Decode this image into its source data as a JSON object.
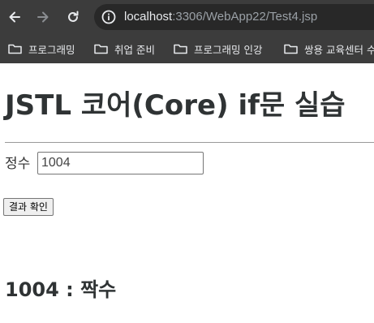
{
  "browser": {
    "url_host": "localhost",
    "url_rest": ":3306/WebApp22/Test4.jsp",
    "bookmarks": [
      {
        "label": "프로그래밍"
      },
      {
        "label": "취업 준비"
      },
      {
        "label": "프로그래밍 인강"
      },
      {
        "label": "쌍용 교육센터 수"
      }
    ]
  },
  "page": {
    "title": "JSTL 코어(Core) if문 실습",
    "field_label": "정수",
    "input_value": "1004",
    "submit_label": "결과 확인",
    "result": "1004 : 짝수"
  },
  "colors": {
    "chrome_bg": "#3c3c3c",
    "text_dark": "#2f3334"
  }
}
